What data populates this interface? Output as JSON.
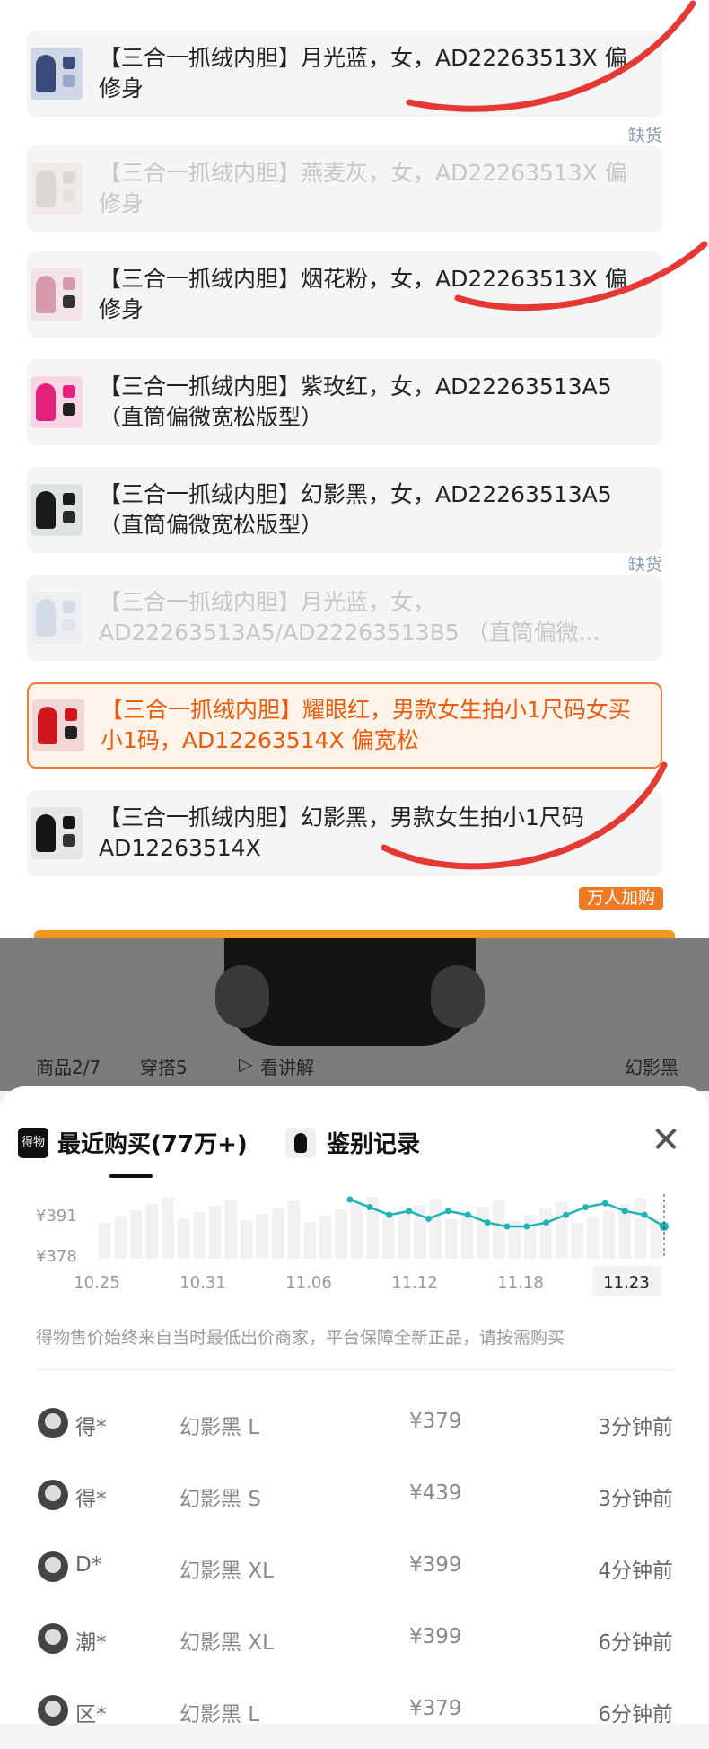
{
  "sku_list": {
    "items": [
      {
        "label": "【三合一抓绒内胆】月光蓝，女，AD22263513X 偏修身",
        "state": "normal",
        "colors": [
          "#cfd6e6",
          "#3a4a7a",
          "#9aa8c8"
        ]
      },
      {
        "label": "【三合一抓绒内胆】燕麦灰，女，AD22263513X 偏修身",
        "state": "out_of_stock",
        "colors": [
          "#e9e2d8",
          "#bfb3a4",
          "#d8c9b8"
        ]
      },
      {
        "label": "【三合一抓绒内胆】烟花粉，女，AD22263513X 偏修身",
        "state": "normal",
        "colors": [
          "#f2e4e8",
          "#d79aab",
          "#333333"
        ]
      },
      {
        "label": "【三合一抓绒内胆】紫玫红，女，AD22263513A5 （直筒偏微宽松版型）",
        "state": "normal",
        "colors": [
          "#f7d7e6",
          "#e4207d",
          "#222222"
        ]
      },
      {
        "label": "【三合一抓绒内胆】幻影黑，女，AD22263513A5 （直筒偏微宽松版型）",
        "state": "normal",
        "colors": [
          "#dde4de",
          "#1a1a1a",
          "#2a2a2a"
        ]
      },
      {
        "label": "【三合一抓绒内胆】月光蓝，女，AD22263513A5/AD22263513B5 （直筒偏微...",
        "state": "out_of_stock",
        "colors": [
          "#e2e6ee",
          "#b0bcd4",
          "#c8d0de"
        ]
      },
      {
        "label": "【三合一抓绒内胆】耀眼红，男款女生拍小1尺码女买小1码，AD12263514X 偏宽松",
        "state": "selected",
        "colors": [
          "#f1d6d6",
          "#d1161e",
          "#222222"
        ]
      },
      {
        "label": "【三合一抓绒内胆】幻影黑，男款女生拍小1尺码AD12263514X",
        "state": "normal",
        "colors": [
          "#e6e6e6",
          "#151515",
          "#333333"
        ]
      }
    ],
    "out_of_stock_label": "缺货",
    "popular_badge": "万人加购"
  },
  "product_bar": {
    "counter": "商品2/7",
    "outfit": "穿搭5",
    "explain": "看讲解",
    "color": "幻影黑"
  },
  "sheet": {
    "tab_recent_icon": "得物",
    "tab_recent": "最近购买(77万+)",
    "tab_auth": "鉴别记录",
    "close_icon": "close-icon"
  },
  "chart_data": {
    "type": "line",
    "y_tick_labels": [
      "¥391",
      "¥378"
    ],
    "x_tick_labels": [
      "10.25",
      "10.31",
      "11.06",
      "11.12",
      "11.18",
      "11.23"
    ],
    "highlighted_x": "11.23",
    "series": [
      {
        "values": [
          392,
          390,
          388,
          389,
          387,
          389,
          388,
          386,
          385,
          385,
          386,
          388,
          390,
          391,
          389,
          388,
          385
        ]
      }
    ],
    "line_color": "#1fb3b3"
  },
  "notice": "得物售价始终来自当时最低出价商家，平台保障全新正品，请按需购买",
  "purchases": [
    {
      "user": "得*",
      "spec": "幻影黑 L",
      "price": "¥379",
      "time": "3分钟前"
    },
    {
      "user": "得*",
      "spec": "幻影黑 S",
      "price": "¥439",
      "time": "3分钟前"
    },
    {
      "user": "D*",
      "spec": "幻影黑 XL",
      "price": "¥399",
      "time": "4分钟前"
    },
    {
      "user": "潮*",
      "spec": "幻影黑 XL",
      "price": "¥399",
      "time": "6分钟前"
    },
    {
      "user": "区*",
      "spec": "幻影黑 L",
      "price": "¥379",
      "time": "6分钟前"
    }
  ]
}
